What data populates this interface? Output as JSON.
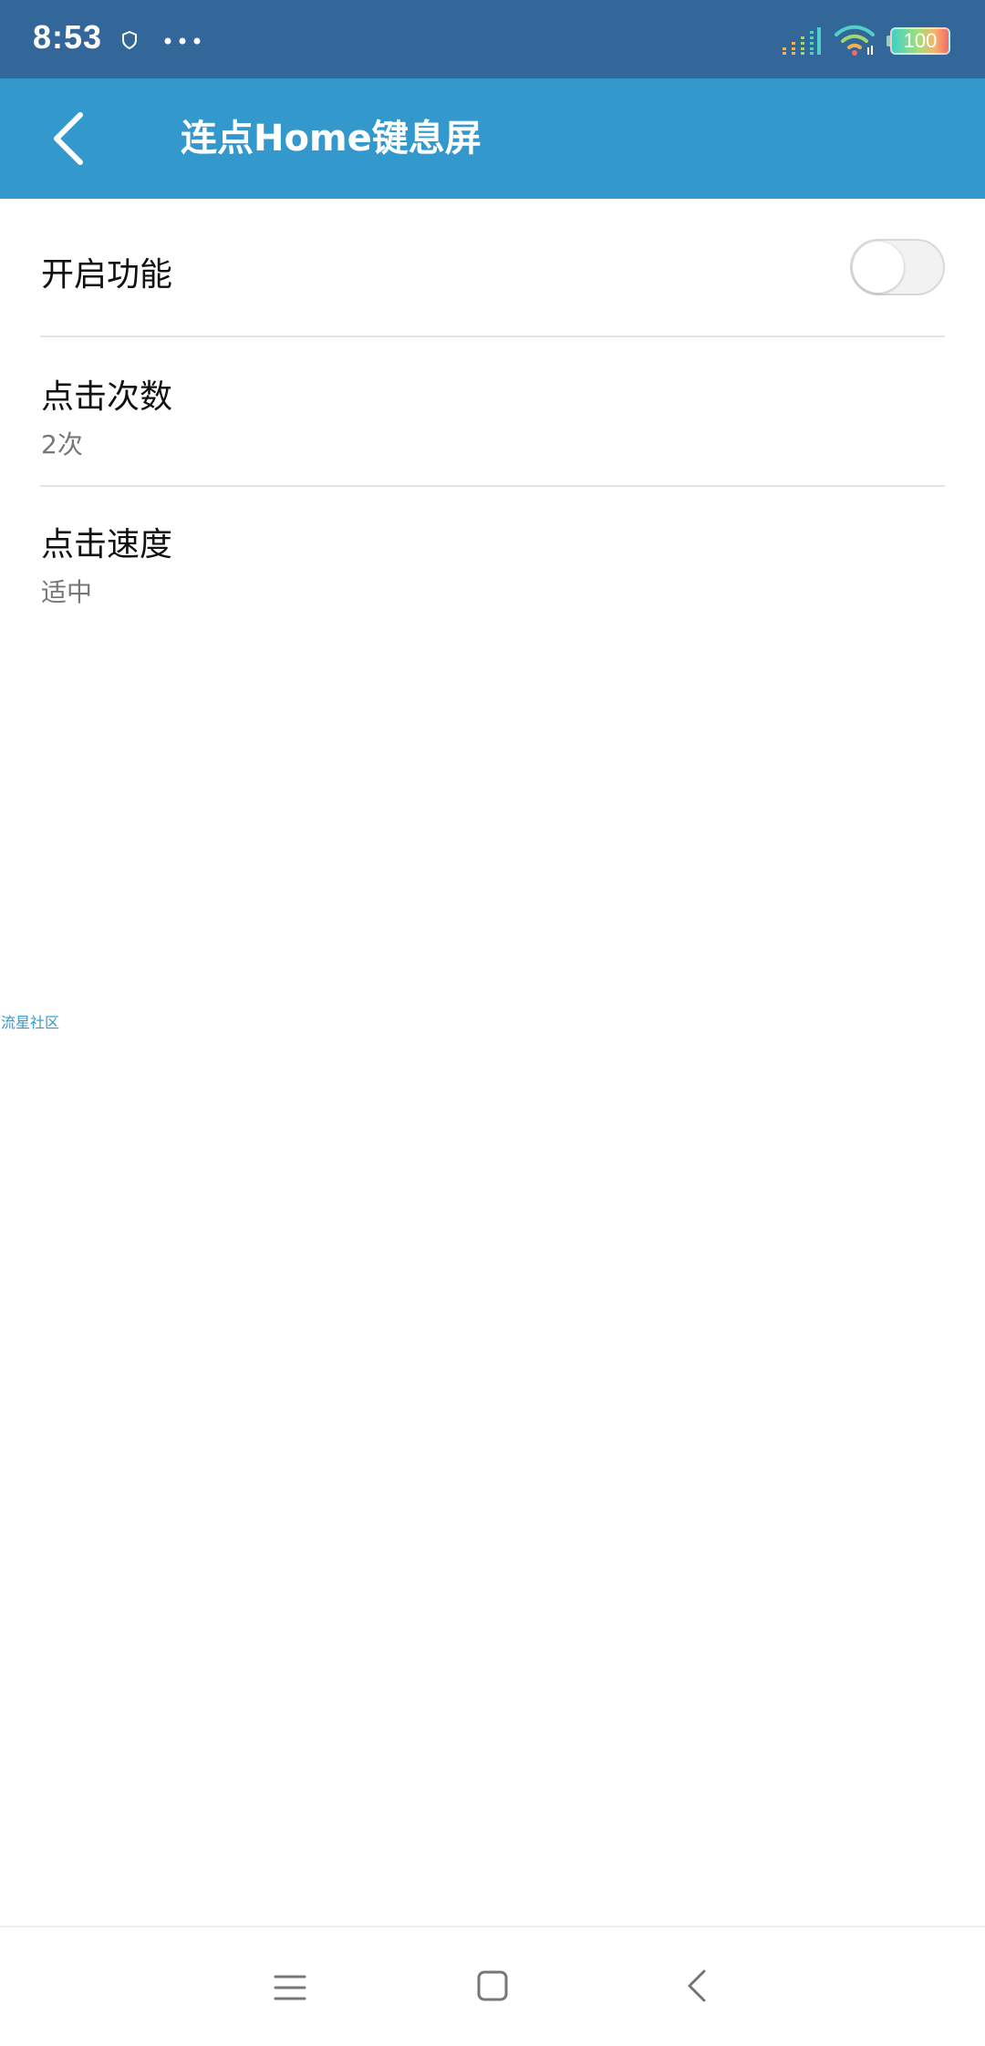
{
  "status_bar": {
    "time": "8:53",
    "battery_level": "100",
    "icons": [
      "shield-icon",
      "more-dots-icon",
      "signal-icon",
      "wifi-icon",
      "battery-icon"
    ]
  },
  "app_bar": {
    "title": "连点Home键息屏",
    "background_color": "#3399cc",
    "back_icon": "chevron-left-icon"
  },
  "settings": {
    "enable": {
      "label": "开启功能",
      "toggle_on": false
    },
    "tap_count": {
      "label": "点击次数",
      "value": "2次"
    },
    "tap_speed": {
      "label": "点击速度",
      "value": "适中"
    }
  },
  "watermark": "流星社区",
  "nav_bar": {
    "icons": [
      "menu-icon",
      "home-icon",
      "back-icon"
    ]
  },
  "colors": {
    "status_bar": "#336699",
    "accent": "#3399cc",
    "divider": "#e3e3e3"
  }
}
